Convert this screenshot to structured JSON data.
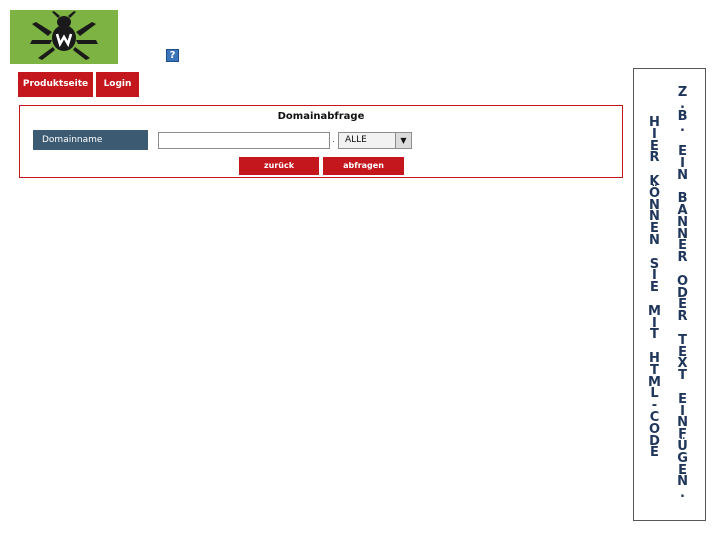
{
  "logo": {
    "icon": "spider-logo-icon",
    "background": "#7cb342"
  },
  "help": {
    "icon": "help-icon",
    "label": "?"
  },
  "nav": {
    "produktseite": "Produktseite",
    "login": "Login"
  },
  "form": {
    "title": "Domainabfrage",
    "label": "Domainname",
    "input_value": "",
    "dot": ".",
    "tld_selected": "ALLE",
    "back_button": "zurück",
    "query_button": "abfragen"
  },
  "banner": {
    "line1": "HIER KÖNNEN SIE MIT HTML-CODE",
    "line2": "Z.B. EIN BANNER ODER TEXT EINFÜGEN."
  },
  "colors": {
    "accent_red": "#c4171d",
    "label_blue": "#3d5a73",
    "banner_text": "#20365a"
  }
}
